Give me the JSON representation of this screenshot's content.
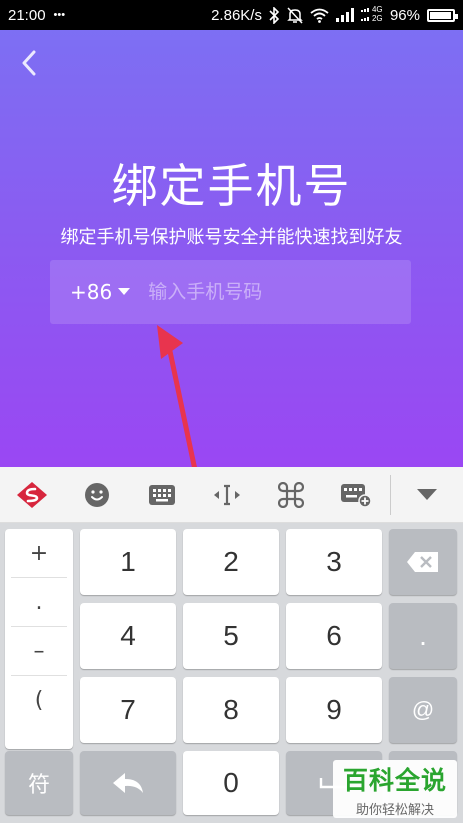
{
  "status_bar": {
    "time": "21:00",
    "dots": "•••",
    "speed": "2.86K/s",
    "signal_label_top": "4G",
    "signal_label_bottom": "2G",
    "battery": "96%",
    "battery_level": 0.96
  },
  "header": {
    "title": "绑定手机号",
    "subtitle": "绑定手机号保护账号安全并能快速找到好友"
  },
  "phone_form": {
    "country_code": "+86",
    "input_value": "",
    "input_placeholder": "输入手机号码"
  },
  "colors": {
    "gradient_top": "#7d6ff3",
    "gradient_bottom": "#9a47f3",
    "arrow": "#e8344e",
    "watermark_green": "#2aa52f"
  },
  "keyboard_toolbar": {
    "items": [
      "sogou-logo-icon",
      "emoji-icon",
      "keyboard-icon",
      "cursor-move-icon",
      "command-icon",
      "keyboard-settings-icon",
      "collapse-icon"
    ]
  },
  "keyboard": {
    "symbols": [
      "+",
      ".",
      "–",
      "("
    ],
    "row1": [
      "1",
      "2",
      "3"
    ],
    "row2": [
      "4",
      "5",
      "6"
    ],
    "row3": [
      "7",
      "8",
      "9"
    ],
    "dot_key": ".",
    "at_key": "@",
    "symbol_switch": "符",
    "zero": "0"
  },
  "watermark": {
    "main": "百科全说",
    "sub": "助你轻松解决"
  }
}
